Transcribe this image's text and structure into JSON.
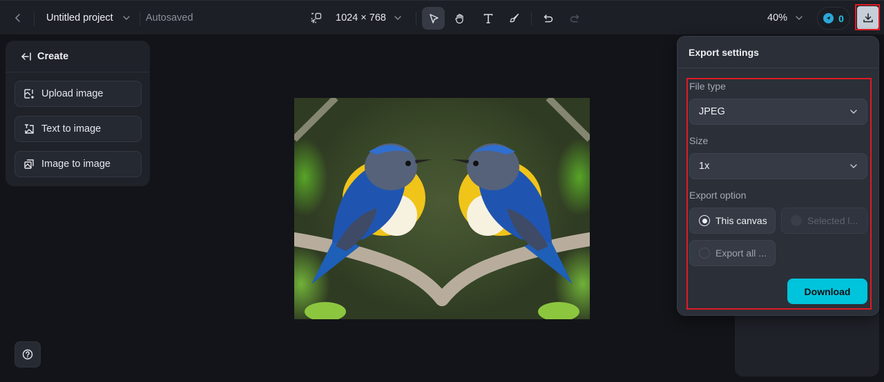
{
  "topbar": {
    "back_icon": "chevron-left-icon",
    "project_title": "Untitled project",
    "save_status": "Autosaved",
    "canvas_size": "1024 × 768",
    "tools": [
      {
        "name": "select",
        "icon": "cursor-arrow-icon",
        "active": true
      },
      {
        "name": "hand",
        "icon": "hand-icon",
        "active": false
      },
      {
        "name": "text",
        "icon": "text-icon",
        "active": false
      },
      {
        "name": "brush",
        "icon": "brush-icon",
        "active": false
      }
    ],
    "undo_icon": "undo-icon",
    "redo_icon": "redo-icon",
    "zoom_level": "40%",
    "credits": "0",
    "download_icon": "download-icon"
  },
  "create_panel": {
    "title": "Create",
    "items": [
      {
        "label": "Upload image",
        "icon": "upload-image-icon"
      },
      {
        "label": "Text to image",
        "icon": "text-to-image-icon"
      },
      {
        "label": "Image to image",
        "icon": "image-to-image-icon"
      }
    ]
  },
  "canvas": {
    "image_description": "Two mirrored blue-and-yellow birds perched on a V-shaped branch"
  },
  "export": {
    "title": "Export settings",
    "file_type_label": "File type",
    "file_type_value": "JPEG",
    "size_label": "Size",
    "size_value": "1x",
    "option_label": "Export option",
    "options": [
      {
        "label": "This canvas",
        "checked": true,
        "disabled": false
      },
      {
        "label": "Selected l...",
        "checked": false,
        "disabled": true
      },
      {
        "label": "Export all ...",
        "checked": false,
        "disabled": false
      }
    ],
    "download_label": "Download"
  },
  "colors": {
    "accent": "#00c4dc",
    "highlight_outline": "#e01b24",
    "background": "#131419",
    "panel": "#1f2229"
  }
}
